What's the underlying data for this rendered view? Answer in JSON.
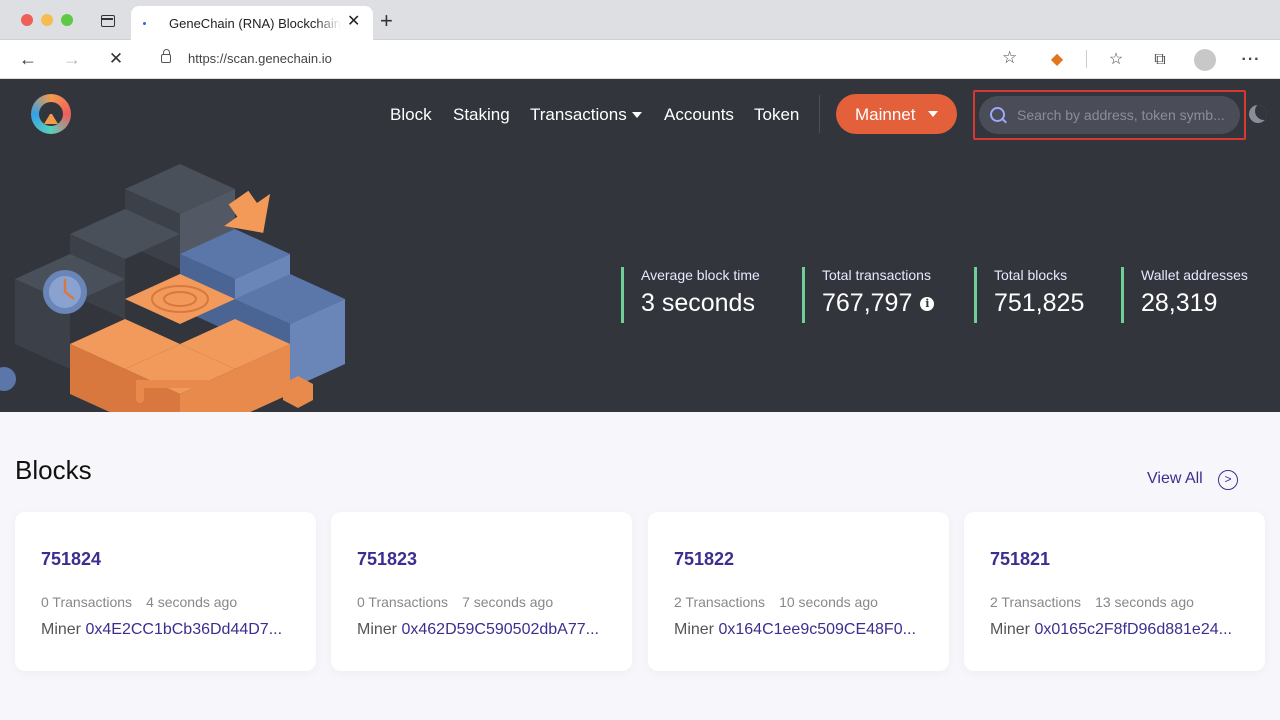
{
  "browser": {
    "tab_title": "GeneChain (RNA) Blockchain E",
    "url": "https://scan.genechain.io"
  },
  "nav": {
    "block": "Block",
    "staking": "Staking",
    "transactions": "Transactions",
    "accounts": "Accounts",
    "token": "Token",
    "network": "Mainnet"
  },
  "search": {
    "placeholder": "Search by address, token symb..."
  },
  "stats": [
    {
      "label": "Average block time",
      "value": "3 seconds"
    },
    {
      "label": "Total transactions",
      "value": "767,797"
    },
    {
      "label": "Total blocks",
      "value": "751,825"
    },
    {
      "label": "Wallet addresses",
      "value": "28,319"
    }
  ],
  "blocks_section": {
    "title": "Blocks",
    "view_all": "View All",
    "miner_label": "Miner",
    "cards": [
      {
        "number": "751824",
        "transactions": "0 Transactions",
        "age": "4 seconds ago",
        "miner": "0x4E2CC1bCb36Dd44D7..."
      },
      {
        "number": "751823",
        "transactions": "0 Transactions",
        "age": "7 seconds ago",
        "miner": "0x462D59C590502dbA77..."
      },
      {
        "number": "751822",
        "transactions": "2 Transactions",
        "age": "10 seconds ago",
        "miner": "0x164C1ee9c509CE48F0..."
      },
      {
        "number": "751821",
        "transactions": "2 Transactions",
        "age": "13 seconds ago",
        "miner": "0x0165c2F8fD96d881e24..."
      }
    ]
  },
  "colors": {
    "hero_bg": "#33353d",
    "accent_orange": "#e4603b",
    "link_purple": "#3a2f8f",
    "stat_bar_green": "#6fcf97",
    "search_highlight": "#d8382f"
  }
}
